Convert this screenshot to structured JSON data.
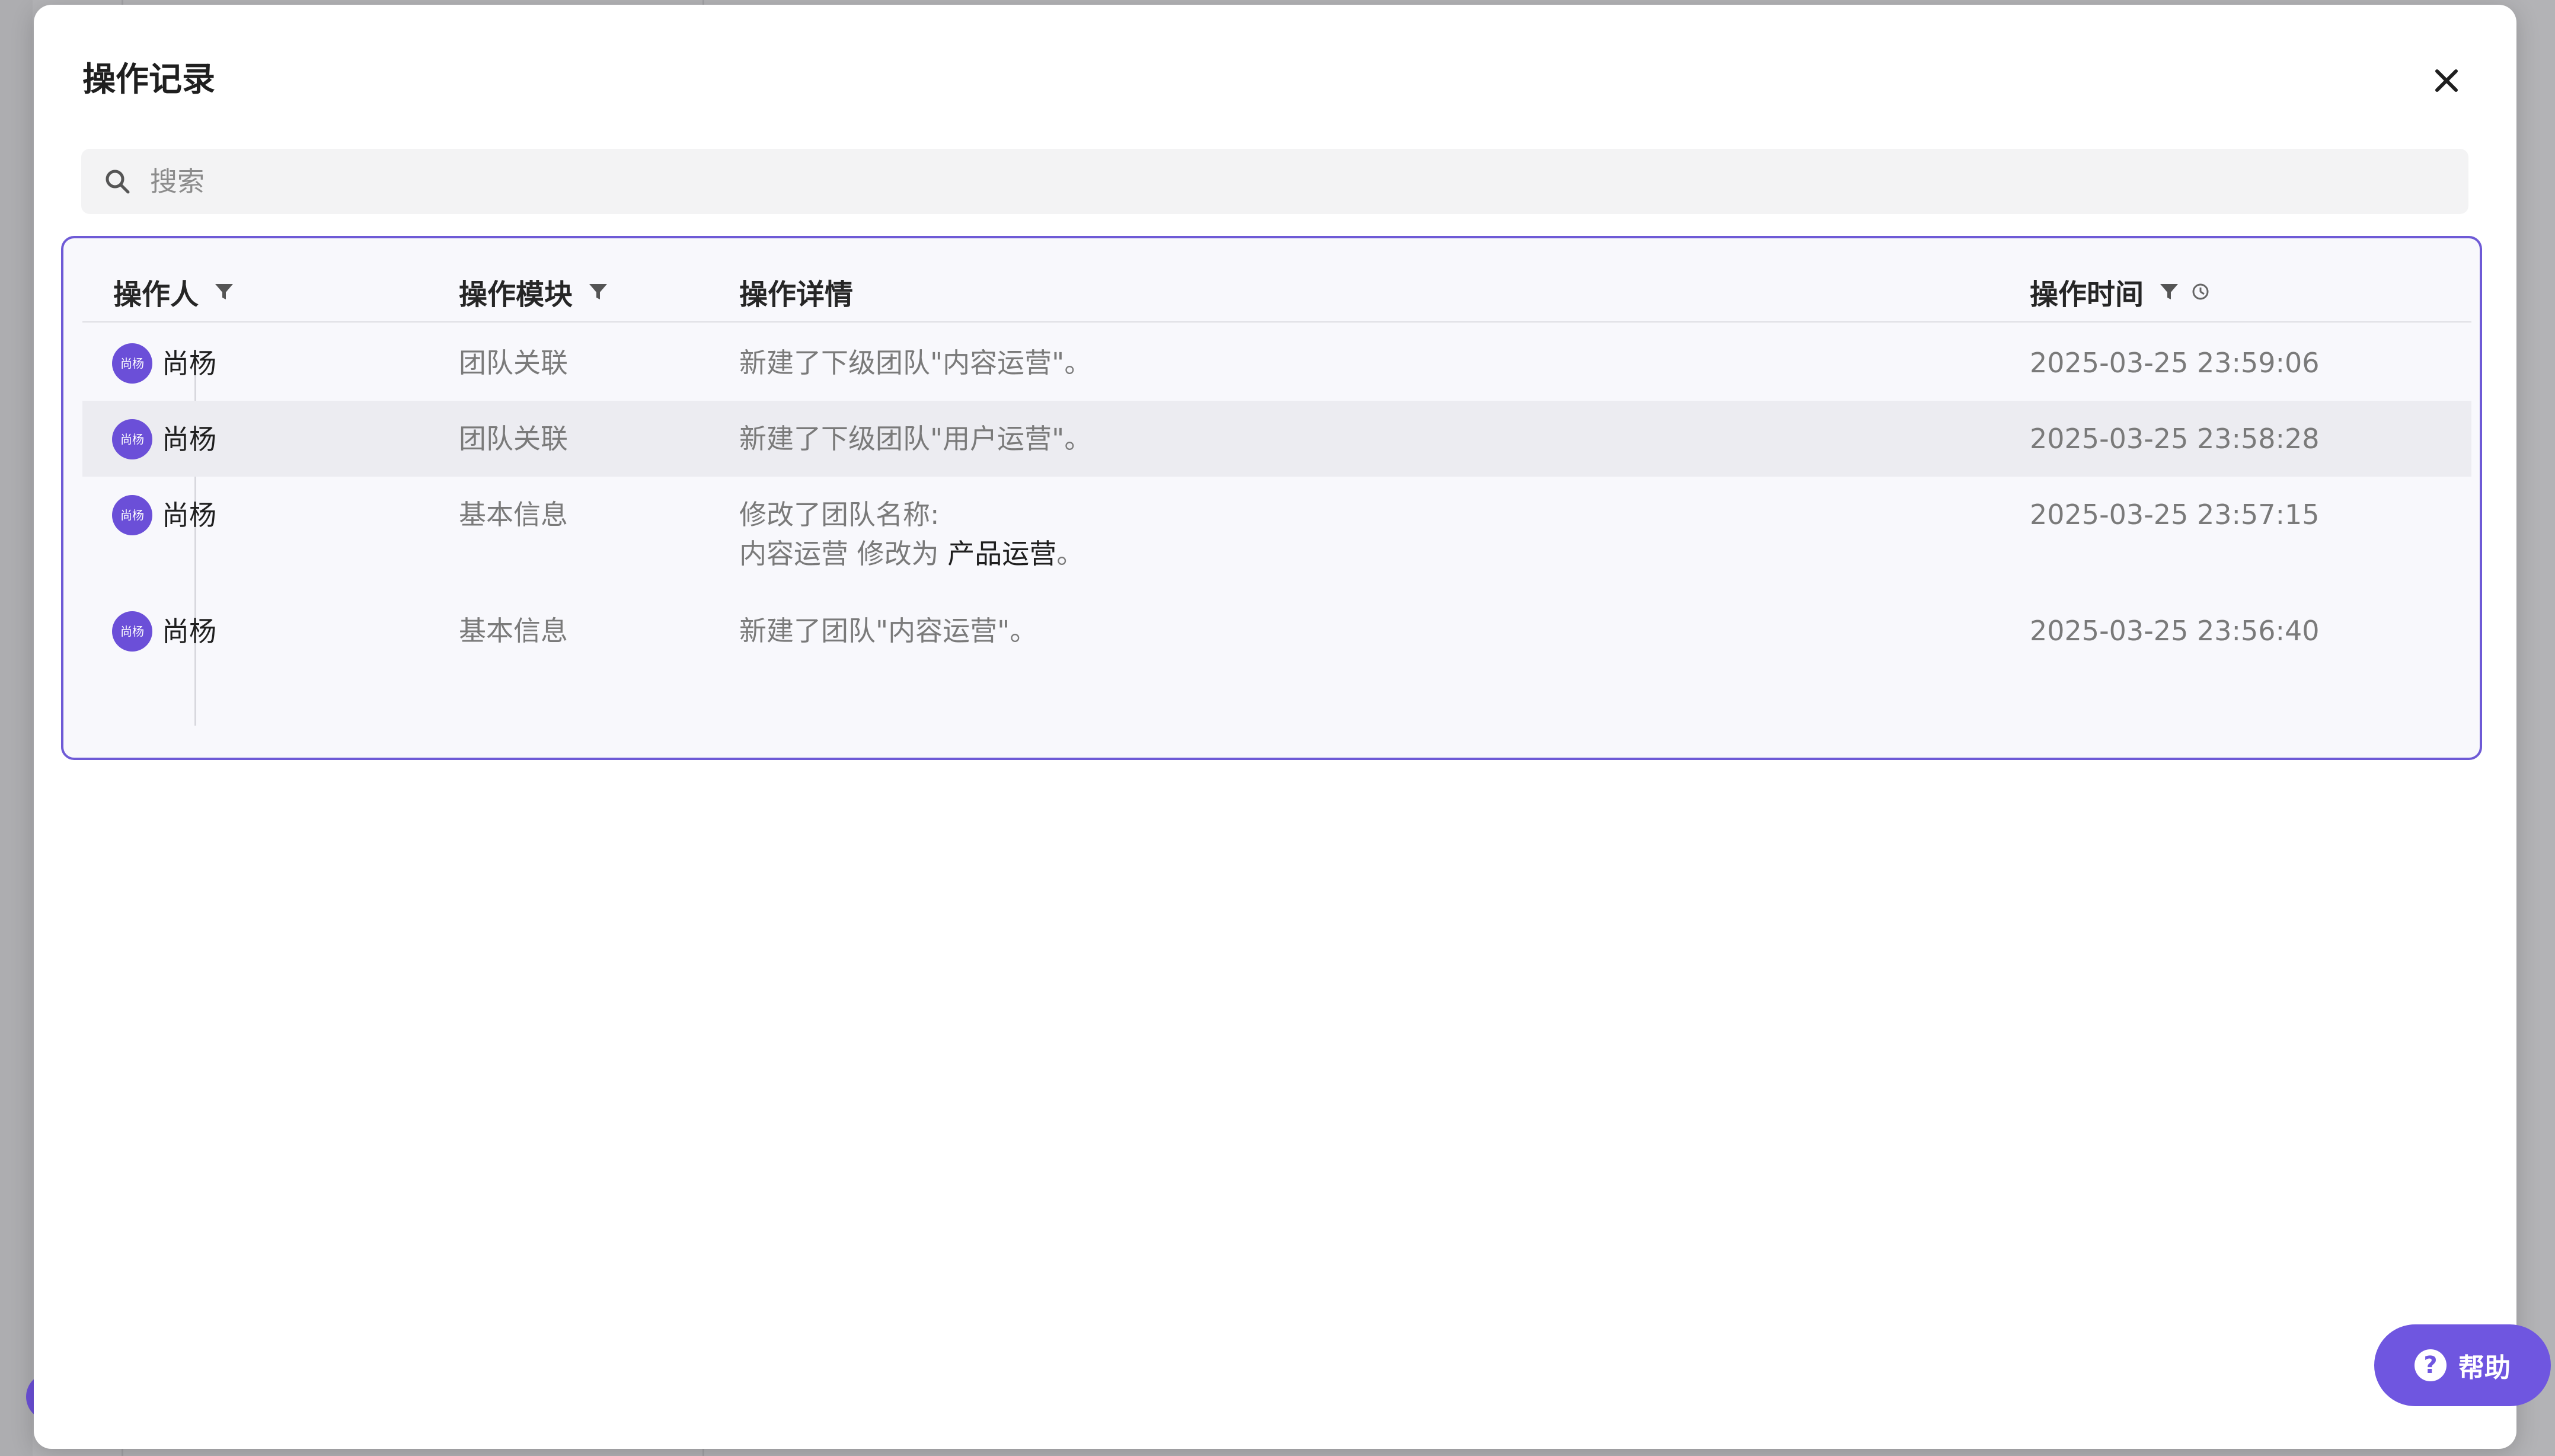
{
  "modal": {
    "title": "操作记录"
  },
  "search": {
    "placeholder": "搜索"
  },
  "table": {
    "columns": {
      "operator": "操作人",
      "module": "操作模块",
      "detail": "操作详情",
      "time": "操作时间"
    },
    "rows": [
      {
        "avatar_text": "尚杨",
        "operator": "尚杨",
        "module": "团队关联",
        "detail": "新建了下级团队\"内容运营\"。",
        "time": "2025-03-25 23:59:06"
      },
      {
        "avatar_text": "尚杨",
        "operator": "尚杨",
        "module": "团队关联",
        "detail": "新建了下级团队\"用户运营\"。",
        "time": "2025-03-25 23:58:28"
      },
      {
        "avatar_text": "尚杨",
        "operator": "尚杨",
        "module": "基本信息",
        "detail_line1": "修改了团队名称:",
        "detail_line2_prefix": "内容运营 修改为 ",
        "detail_line2_value": "产品运营",
        "detail_line2_suffix": "。",
        "time": "2025-03-25 23:57:15"
      },
      {
        "avatar_text": "尚杨",
        "operator": "尚杨",
        "module": "基本信息",
        "detail": "新建了团队\"内容运营\"。",
        "time": "2025-03-25 23:56:40"
      }
    ]
  },
  "help": {
    "label": "帮助"
  },
  "colors": {
    "accent": "#6f56e0",
    "panel_border": "#6e5ad6",
    "row_highlight": "#ececf1"
  },
  "icons": [
    "close-icon",
    "search-icon",
    "filter-icon",
    "clock-icon",
    "help-icon"
  ]
}
